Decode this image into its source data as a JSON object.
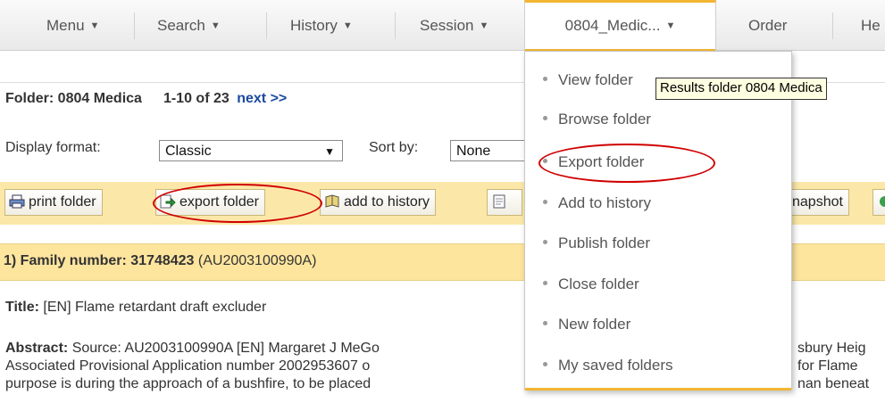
{
  "nav": {
    "items": [
      {
        "label": "Menu"
      },
      {
        "label": "Search"
      },
      {
        "label": "History"
      },
      {
        "label": "Session"
      },
      {
        "label": "0804_Medic..."
      },
      {
        "label": "Order"
      },
      {
        "label": "He"
      }
    ]
  },
  "folder": {
    "title": "Folder: 0804 Medica",
    "range": "1-10 of 23",
    "next_link": "next >>"
  },
  "display": {
    "format_label": "Display format:",
    "format_value": "Classic",
    "sort_label": "Sort by:",
    "sort_value": "None"
  },
  "toolbar": {
    "print_folder": "print folder",
    "export_folder": "export folder",
    "add_to_history": "add to history",
    "snapshot": "napshot"
  },
  "result": {
    "family_label": "1) Family number: 31748423",
    "family_code": "(AU2003100990A)",
    "title_label": "Title:",
    "title_value": "[EN] Flame retardant draft excluder",
    "abstract_label": "Abstract:",
    "abstract_line1": "Source: AU2003100990A [EN] Margaret J MeGo",
    "abstract_line1_right": "sbury Heig",
    "abstract_line2": "Associated Provisional Application number 2002953607 o",
    "abstract_line2_right": "for Flame",
    "abstract_line3": "purpose is during the approach of a bushfire, to be placed",
    "abstract_line3_right": "nan beneat"
  },
  "dropdown": {
    "items": [
      {
        "label": "View folder"
      },
      {
        "label": "Browse folder"
      },
      {
        "label": "Export folder"
      },
      {
        "label": "Add to history"
      },
      {
        "label": "Publish folder"
      },
      {
        "label": "Close folder"
      },
      {
        "label": "New folder"
      },
      {
        "label": "My saved folders"
      }
    ]
  },
  "tooltip": {
    "text": "Results folder 0804 Medica"
  },
  "colors": {
    "accent": "#f2b632",
    "toolbar_bg": "#fbe8a8",
    "family_bar_bg": "#fde59e",
    "annotation": "#d00000",
    "link": "#1b4aa0"
  }
}
